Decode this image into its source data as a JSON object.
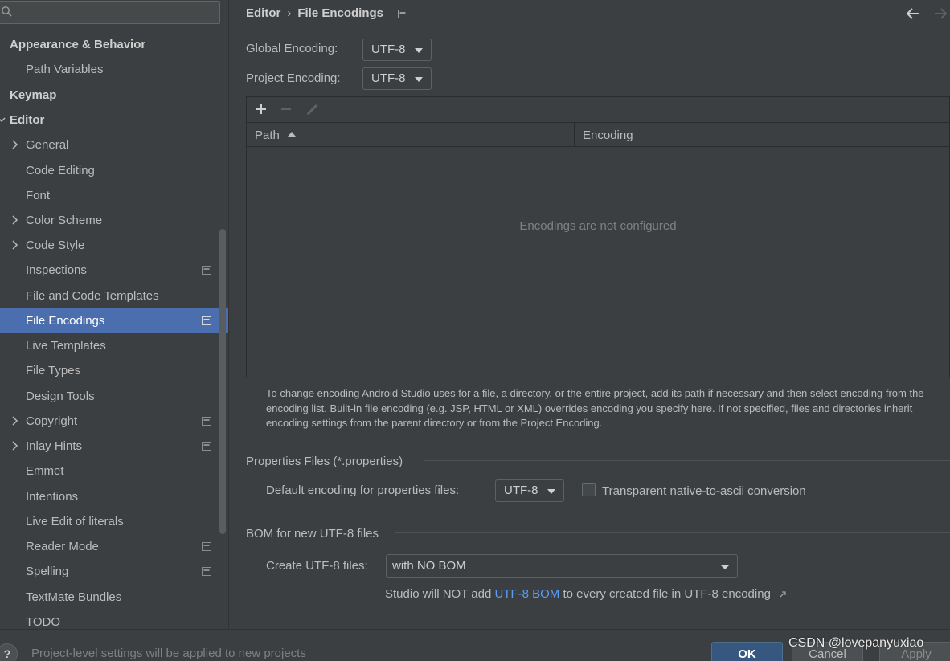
{
  "search": {
    "placeholder": ""
  },
  "sidebar": {
    "items": [
      {
        "label": "Appearance & Behavior",
        "bold": true,
        "indent": 12,
        "chevron": "none"
      },
      {
        "label": "Path Variables",
        "indent": 32,
        "chevron": "none"
      },
      {
        "label": "Keymap",
        "bold": true,
        "indent": 12,
        "chevron": "none"
      },
      {
        "label": "Editor",
        "bold": true,
        "indent": 12,
        "chevron": "open"
      },
      {
        "label": "General",
        "indent": 32,
        "chevron": "closed"
      },
      {
        "label": "Code Editing",
        "indent": 32,
        "chevron": "none"
      },
      {
        "label": "Font",
        "indent": 32,
        "chevron": "none"
      },
      {
        "label": "Color Scheme",
        "indent": 32,
        "chevron": "closed"
      },
      {
        "label": "Code Style",
        "indent": 32,
        "chevron": "closed"
      },
      {
        "label": "Inspections",
        "indent": 32,
        "chevron": "none",
        "project_icon": true
      },
      {
        "label": "File and Code Templates",
        "indent": 32,
        "chevron": "none"
      },
      {
        "label": "File Encodings",
        "indent": 32,
        "chevron": "none",
        "project_icon": true,
        "selected": true
      },
      {
        "label": "Live Templates",
        "indent": 32,
        "chevron": "none"
      },
      {
        "label": "File Types",
        "indent": 32,
        "chevron": "none"
      },
      {
        "label": "Design Tools",
        "indent": 32,
        "chevron": "none"
      },
      {
        "label": "Copyright",
        "indent": 32,
        "chevron": "closed",
        "project_icon": true
      },
      {
        "label": "Inlay Hints",
        "indent": 32,
        "chevron": "closed",
        "project_icon": true
      },
      {
        "label": "Emmet",
        "indent": 32,
        "chevron": "none"
      },
      {
        "label": "Intentions",
        "indent": 32,
        "chevron": "none"
      },
      {
        "label": "Live Edit of literals",
        "indent": 32,
        "chevron": "none"
      },
      {
        "label": "Reader Mode",
        "indent": 32,
        "chevron": "none",
        "project_icon": true
      },
      {
        "label": "Spelling",
        "indent": 32,
        "chevron": "none",
        "project_icon": true
      },
      {
        "label": "TextMate Bundles",
        "indent": 32,
        "chevron": "none"
      },
      {
        "label": "TODO",
        "indent": 32,
        "chevron": "none"
      }
    ]
  },
  "breadcrumb": {
    "parent": "Editor",
    "separator": "›",
    "current": "File Encodings"
  },
  "encodings": {
    "global_label": "Global Encoding:",
    "global_value": "UTF-8",
    "project_label": "Project Encoding:",
    "project_value": "UTF-8"
  },
  "table": {
    "columns": [
      "Path",
      "Encoding"
    ],
    "empty_text": "Encodings are not configured",
    "toolbar_icons": [
      "add-icon",
      "remove-icon",
      "edit-icon"
    ]
  },
  "info_text": "To change encoding Android Studio uses for a file, a directory, or the entire project, add its path if necessary and then select encoding from the encoding list. Built-in file encoding (e.g. JSP, HTML or XML) overrides encoding you specify here. If not specified, files and directories inherit encoding settings from the parent directory or from the Project Encoding.",
  "properties": {
    "section_title": "Properties Files (*.properties)",
    "default_label": "Default encoding for properties files:",
    "default_value": "UTF-8",
    "transparent_label": "Transparent native-to-ascii conversion",
    "transparent_checked": false
  },
  "bom": {
    "section_title": "BOM for new UTF-8 files",
    "create_label": "Create UTF-8 files:",
    "create_value": "with NO BOM",
    "note_prefix": "Studio will NOT add ",
    "note_link": "UTF-8 BOM",
    "note_suffix": " to every created file in UTF-8 encoding"
  },
  "bottom": {
    "help": "?",
    "message": "Project-level settings will be applied to new projects",
    "ok": "OK",
    "cancel": "Cancel",
    "apply": "Apply"
  },
  "watermark": "CSDN @lovepanyuxiao",
  "colors": {
    "selection": "#4b6eaf",
    "link": "#589df6",
    "ok_button": "#365880",
    "background": "#3c3f41"
  }
}
